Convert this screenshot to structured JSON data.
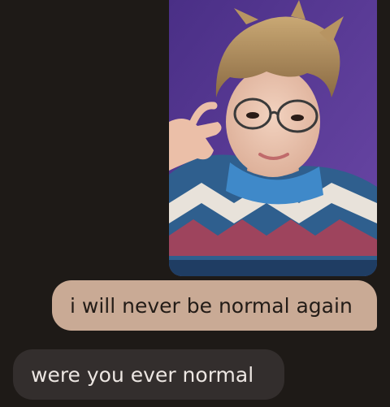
{
  "conversation": {
    "messages": [
      {
        "type": "image",
        "direction": "received",
        "alt_subject": "selfie photo"
      },
      {
        "type": "text",
        "direction": "sent",
        "text": "i will never be normal again"
      },
      {
        "type": "text",
        "direction": "received",
        "text": "were you ever normal"
      }
    ]
  },
  "colors": {
    "background": "#1e1a17",
    "sent_bubble": "#c9aa95",
    "sent_text": "#231c17",
    "received_bubble": "#332e2d",
    "received_text": "#ece6e2",
    "photo_backdrop": "#5b3a8c"
  }
}
